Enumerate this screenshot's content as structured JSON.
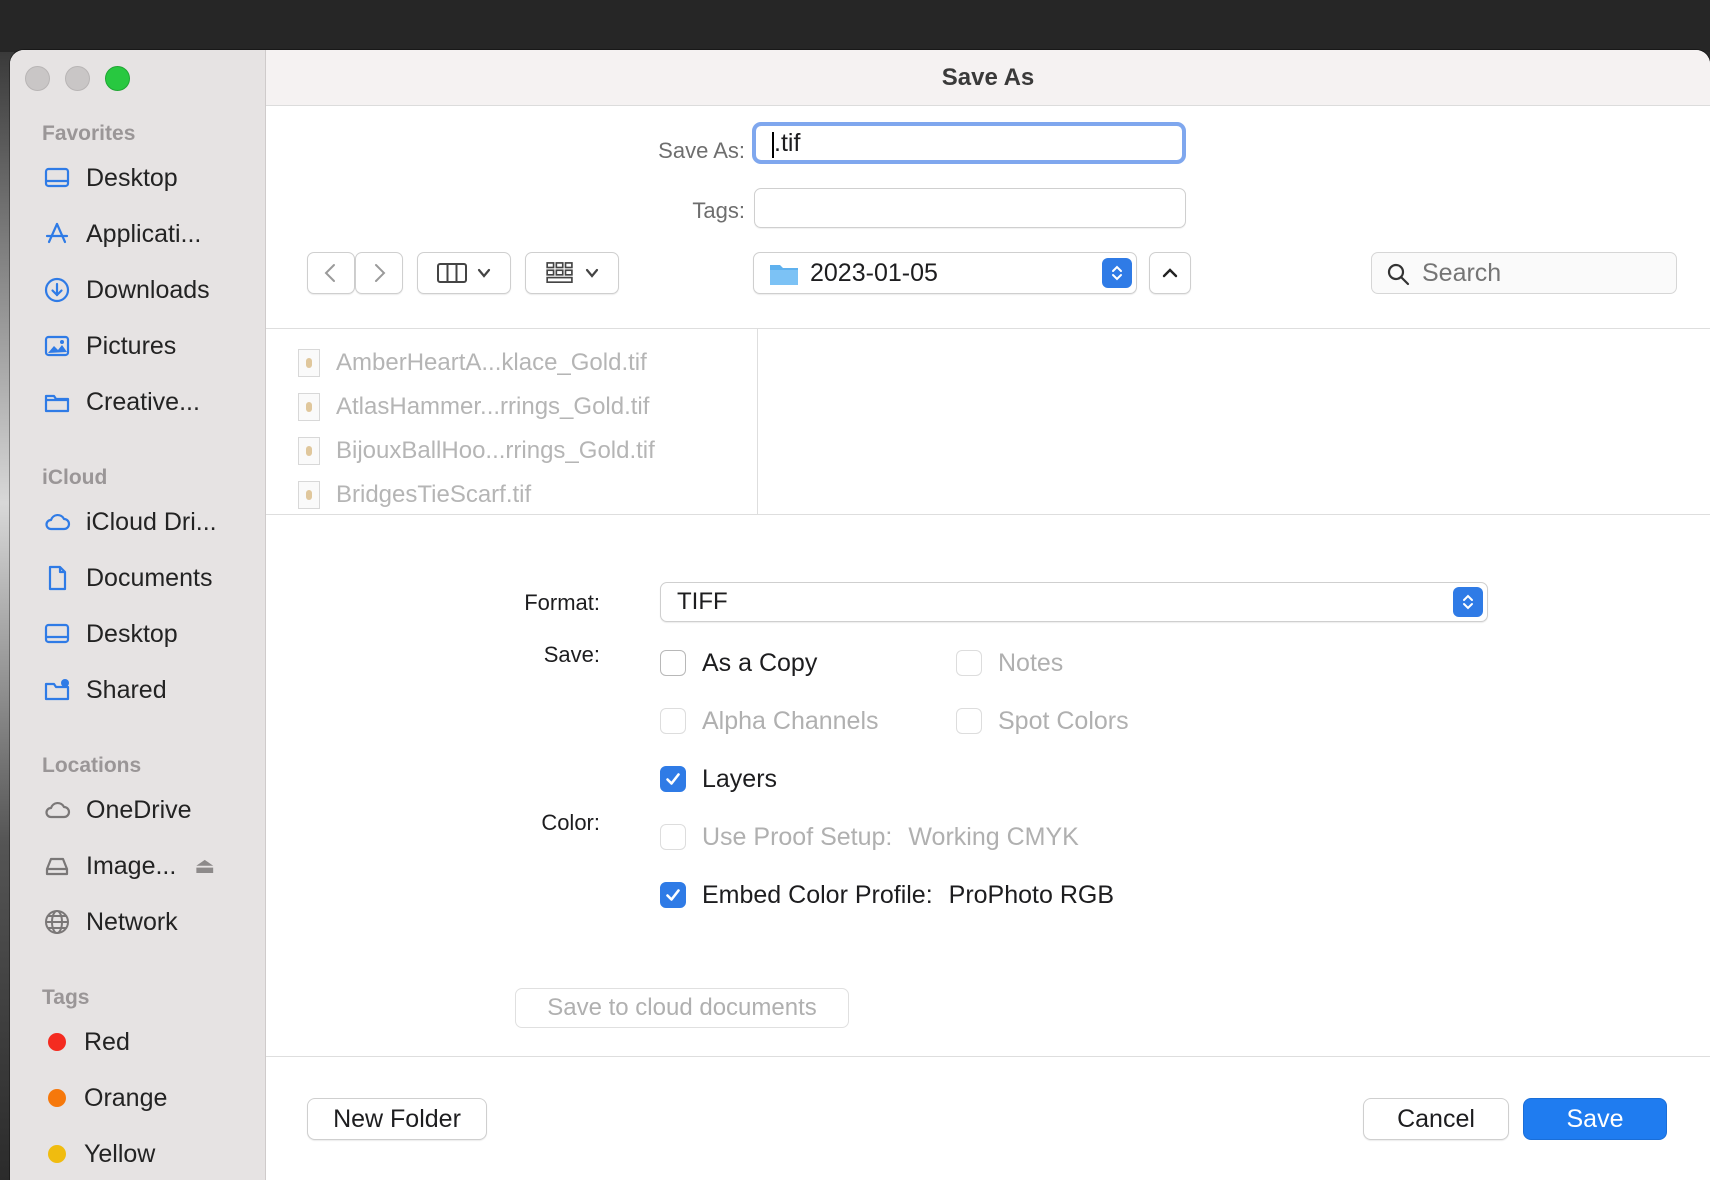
{
  "window": {
    "title": "Save As"
  },
  "sidebar": {
    "sections": {
      "favorites": "Favorites",
      "icloud": "iCloud",
      "locations": "Locations",
      "tags": "Tags"
    },
    "favorites": [
      {
        "label": "Desktop",
        "icon": "desktop-icon"
      },
      {
        "label": "Applicati...",
        "icon": "applications-icon"
      },
      {
        "label": "Downloads",
        "icon": "downloads-icon"
      },
      {
        "label": "Pictures",
        "icon": "pictures-icon"
      },
      {
        "label": "Creative...",
        "icon": "folder-icon"
      }
    ],
    "icloud": [
      {
        "label": "iCloud Dri...",
        "icon": "cloud-icon"
      },
      {
        "label": "Documents",
        "icon": "document-icon"
      },
      {
        "label": "Desktop",
        "icon": "desktop-icon"
      },
      {
        "label": "Shared",
        "icon": "shared-folder-icon"
      }
    ],
    "locations": [
      {
        "label": "OneDrive",
        "icon": "cloud-icon"
      },
      {
        "label": "Image...",
        "icon": "drive-icon"
      },
      {
        "label": "Network",
        "icon": "globe-icon"
      }
    ],
    "tags": [
      {
        "label": "Red",
        "color": "#f42b20"
      },
      {
        "label": "Orange",
        "color": "#f6780b"
      },
      {
        "label": "Yellow",
        "color": "#f0bc0f"
      }
    ]
  },
  "form": {
    "save_as_label": "Save As:",
    "save_as_value": ".tif",
    "tags_label": "Tags:",
    "tags_value": ""
  },
  "toolbar": {
    "folder_name": "2023-01-05",
    "search_placeholder": "Search"
  },
  "files": [
    "AmberHeartA...klace_Gold.tif",
    "AtlasHammer...rrings_Gold.tif",
    "BijouxBallHoo...rrings_Gold.tif",
    "BridgesTieScarf.tif"
  ],
  "options": {
    "format_label": "Format:",
    "format_value": "TIFF",
    "save_label": "Save:",
    "color_label": "Color:",
    "as_a_copy": {
      "label": "As a Copy",
      "checked": false,
      "enabled": true
    },
    "notes": {
      "label": "Notes",
      "checked": false,
      "enabled": false
    },
    "alpha_channels": {
      "label": "Alpha Channels",
      "checked": false,
      "enabled": false
    },
    "spot_colors": {
      "label": "Spot Colors",
      "checked": false,
      "enabled": false
    },
    "layers": {
      "label": "Layers",
      "checked": true,
      "enabled": true
    },
    "use_proof_setup": {
      "label": "Use Proof Setup:",
      "value": "Working CMYK",
      "checked": false,
      "enabled": false
    },
    "embed_color_profile": {
      "label": "Embed Color Profile:",
      "value": "ProPhoto RGB",
      "checked": true,
      "enabled": true
    },
    "save_to_cloud": "Save to cloud documents"
  },
  "footer": {
    "new_folder": "New Folder",
    "cancel": "Cancel",
    "save": "Save"
  },
  "colors": {
    "accent": "#1f7cf0",
    "traffic_zoom": "#28c840"
  }
}
